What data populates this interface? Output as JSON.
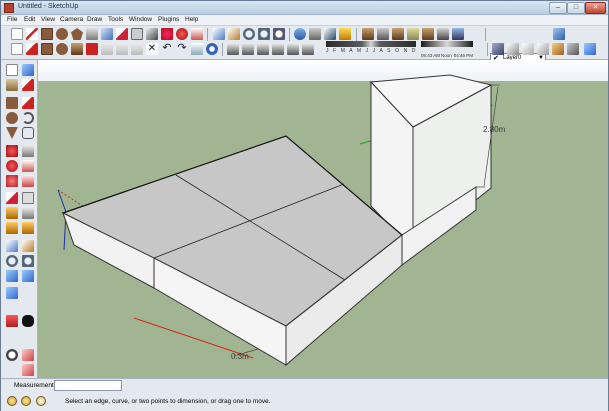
{
  "window": {
    "title": "Untitled - SketchUp",
    "minimize_label": "–",
    "maximize_label": "□",
    "close_label": "✕"
  },
  "menu": [
    {
      "label": "File"
    },
    {
      "label": "Edit"
    },
    {
      "label": "View"
    },
    {
      "label": "Camera"
    },
    {
      "label": "Draw"
    },
    {
      "label": "Tools"
    },
    {
      "label": "Window"
    },
    {
      "label": "Plugins"
    },
    {
      "label": "Help"
    }
  ],
  "layers": {
    "current": "Layer0"
  },
  "shadows": {
    "months": "J F M A M J J A S O N D",
    "time_am": "06:43 AM",
    "time_noon": "Noon",
    "time_pm": "04:46 PM"
  },
  "model": {
    "height_dimension": "2.80m",
    "depth_dimension": "0.3m"
  },
  "measurements": {
    "label": "Measurements",
    "value": ""
  },
  "status": {
    "text": "Select an edge, curve, or two points to dimension, or drag one to move."
  },
  "colors": {
    "ground": "#a2b593",
    "sky": "#ffffff",
    "top_face": "#c7c7c7",
    "side_face": "#f2f2f2",
    "axis_red": "#d02a1a",
    "axis_green": "#22a01e",
    "axis_blue": "#1d2ea8"
  }
}
